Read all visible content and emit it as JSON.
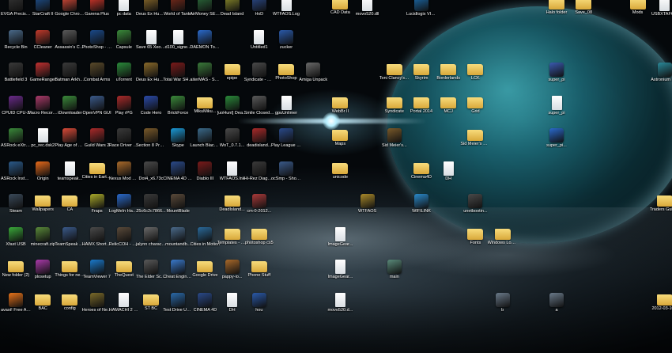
{
  "icons": [
    {
      "label": "EVGA Precision X",
      "col": 0,
      "row": 0,
      "kind": "app",
      "color": "#333333"
    },
    {
      "label": "StarCraft II",
      "col": 1,
      "row": 0,
      "kind": "app",
      "color": "#1d4f8c"
    },
    {
      "label": "Google Chrome",
      "col": 2,
      "row": 0,
      "kind": "app",
      "color": "#d94a38"
    },
    {
      "label": "Garena Plus",
      "col": 3,
      "row": 0,
      "kind": "app",
      "color": "#d8362a"
    },
    {
      "label": "pc data",
      "col": 4,
      "row": 0,
      "kind": "doc",
      "color": "#ffffff"
    },
    {
      "label": "Deus Ex Human R...",
      "col": 5,
      "row": 0,
      "kind": "app",
      "color": "#8a6a2a"
    },
    {
      "label": "World of Tanks",
      "col": 6,
      "row": 0,
      "kind": "app",
      "color": "#7a2a1a"
    },
    {
      "label": "AirMoney SE v7.38",
      "col": 7,
      "row": 0,
      "kind": "app",
      "color": "#2a6a3a"
    },
    {
      "label": "Dead Island",
      "col": 8,
      "row": 0,
      "kind": "app",
      "color": "#8a8a2a"
    },
    {
      "label": "HxD",
      "col": 9,
      "row": 0,
      "kind": "app",
      "color": "#2a4a8a"
    },
    {
      "label": "WTFAOS.Log",
      "col": 10,
      "row": 0,
      "kind": "doc",
      "color": "#ffffff"
    },
    {
      "label": "CAD Data",
      "col": 12,
      "row": 0,
      "kind": "folder",
      "color": "#e8c25a"
    },
    {
      "label": "movo520.dll",
      "col": 13,
      "row": 0,
      "kind": "doc",
      "color": "#ffffff"
    },
    {
      "label": "Lucidlogix VIRTU Settings",
      "col": 15,
      "row": 0,
      "kind": "app",
      "color": "#1a6aaa"
    },
    {
      "label": "Halo folder",
      "col": 20,
      "row": 0,
      "kind": "folder",
      "color": "#e8c25a"
    },
    {
      "label": "Save_08",
      "col": 21,
      "row": 0,
      "kind": "folder",
      "color": "#e8c25a"
    },
    {
      "label": "Mods",
      "col": 23,
      "row": 0,
      "kind": "folder",
      "color": "#e8c25a"
    },
    {
      "label": "USBXTAFG...",
      "col": 24,
      "row": 0,
      "kind": "doc",
      "color": "#ffffff"
    },
    {
      "label": "Recycle Bin",
      "col": 0,
      "row": 1,
      "kind": "app",
      "color": "#4a6a8a"
    },
    {
      "label": "CCleaner",
      "col": 1,
      "row": 1,
      "kind": "app",
      "color": "#c0392b"
    },
    {
      "label": "Assassin's Creed Re...",
      "col": 2,
      "row": 1,
      "kind": "app",
      "color": "#5a5a5a"
    },
    {
      "label": "PhotoShop - Shortcut",
      "col": 3,
      "row": 1,
      "kind": "app",
      "color": "#1a4a8a"
    },
    {
      "label": "Capsule",
      "col": 4,
      "row": 1,
      "kind": "app",
      "color": "#3a8a3a"
    },
    {
      "label": "Save 65 Xeon San...",
      "col": 5,
      "row": 1,
      "kind": "doc",
      "color": "#ffffff"
    },
    {
      "label": "d100_signe...",
      "col": 6,
      "row": 1,
      "kind": "doc",
      "color": "#ffffff"
    },
    {
      "label": "DAEMON Tools Lite",
      "col": 7,
      "row": 1,
      "kind": "app",
      "color": "#2a6acc"
    },
    {
      "label": "Untitled1",
      "col": 9,
      "row": 1,
      "kind": "doc",
      "color": "#ffffff"
    },
    {
      "label": "zucker",
      "col": 10,
      "row": 1,
      "kind": "app",
      "color": "#2a5aaa"
    },
    {
      "label": "Battlefield 3",
      "col": 0,
      "row": 2,
      "kind": "app",
      "color": "#3a3a3a"
    },
    {
      "label": "GameRanger",
      "col": 1,
      "row": 2,
      "kind": "app",
      "color": "#c03030"
    },
    {
      "label": "Batman Arkham City",
      "col": 2,
      "row": 2,
      "kind": "app",
      "color": "#3a3a3a"
    },
    {
      "label": "Combat Arms",
      "col": 3,
      "row": 2,
      "kind": "app",
      "color": "#5a4a2a"
    },
    {
      "label": "uTorrent",
      "col": 4,
      "row": 2,
      "kind": "app",
      "color": "#2a8a3a"
    },
    {
      "label": "Deus Ex Human Re...",
      "col": 5,
      "row": 2,
      "kind": "app",
      "color": "#8a6a2a"
    },
    {
      "label": "Total War SHOGUN 2",
      "col": 6,
      "row": 2,
      "kind": "app",
      "color": "#7a1a1a"
    },
    {
      "label": "aiterMAS - Shortcut",
      "col": 7,
      "row": 2,
      "kind": "app",
      "color": "#3a7a3a"
    },
    {
      "label": "epipe",
      "col": 8,
      "row": 2,
      "kind": "folder",
      "color": "#e8c25a"
    },
    {
      "label": "Syndicate - Shortcut",
      "col": 9,
      "row": 2,
      "kind": "app",
      "color": "#4a4a4a"
    },
    {
      "label": "PhotoShop",
      "col": 10,
      "row": 2,
      "kind": "folder",
      "color": "#e8c25a"
    },
    {
      "label": "Amiga Unpack",
      "col": 11,
      "row": 2,
      "kind": "app",
      "color": "#6a6a6a"
    },
    {
      "label": "Toni Clancy's H.A.W.X",
      "col": 14,
      "row": 2,
      "kind": "folder",
      "color": "#e8c25a"
    },
    {
      "label": "Skyrim",
      "col": 15,
      "row": 2,
      "kind": "folder",
      "color": "#e8c25a"
    },
    {
      "label": "Borderlands",
      "col": 16,
      "row": 2,
      "kind": "folder",
      "color": "#e8c25a"
    },
    {
      "label": "LCK",
      "col": 17,
      "row": 2,
      "kind": "folder",
      "color": "#e8c25a"
    },
    {
      "label": "super_pi",
      "col": 20,
      "row": 2,
      "kind": "app",
      "color": "#3a5ab0"
    },
    {
      "label": "Astronium Lite",
      "col": 24,
      "row": 2,
      "kind": "app",
      "color": "#2a8a9a"
    },
    {
      "label": "CPUID CPU-Z",
      "col": 0,
      "row": 3,
      "kind": "app",
      "color": "#6a2a8a"
    },
    {
      "label": "Macro Recorder",
      "col": 1,
      "row": 3,
      "kind": "app",
      "color": "#aa3a6a"
    },
    {
      "label": "iDownloader",
      "col": 2,
      "row": 3,
      "kind": "app",
      "color": "#3a8a3a"
    },
    {
      "label": "OpenVPN GUI",
      "col": 3,
      "row": 3,
      "kind": "app",
      "color": "#3a5a8a"
    },
    {
      "label": "Play rPG",
      "col": 4,
      "row": 3,
      "kind": "app",
      "color": "#aa2a2a"
    },
    {
      "label": "Code Hero",
      "col": 5,
      "row": 3,
      "kind": "app",
      "color": "#2a4aaa"
    },
    {
      "label": "BrickForce",
      "col": 6,
      "row": 3,
      "kind": "app",
      "color": "#3a8a3a"
    },
    {
      "label": "MikuMiku...",
      "col": 7,
      "row": 3,
      "kind": "folder",
      "color": "#e8c25a"
    },
    {
      "label": "[uoHunt] DeadIsland...",
      "col": 8,
      "row": 3,
      "kind": "app",
      "color": "#2a8a3a"
    },
    {
      "label": "Smile Closed Beta",
      "col": 9,
      "row": 3,
      "kind": "app",
      "color": "#5a5a5a"
    },
    {
      "label": "gpuUnlimer",
      "col": 10,
      "row": 3,
      "kind": "doc",
      "color": "#ffffff"
    },
    {
      "label": "WebBr II",
      "col": 12,
      "row": 3,
      "kind": "folder",
      "color": "#e8c25a"
    },
    {
      "label": "Syndicate",
      "col": 14,
      "row": 3,
      "kind": "folder",
      "color": "#e8c25a"
    },
    {
      "label": "Portal 2014",
      "col": 15,
      "row": 3,
      "kind": "folder",
      "color": "#e8c25a"
    },
    {
      "label": "MCJ",
      "col": 16,
      "row": 3,
      "kind": "folder",
      "color": "#e8c25a"
    },
    {
      "label": "Grid",
      "col": 17,
      "row": 3,
      "kind": "folder",
      "color": "#e8c25a"
    },
    {
      "label": "super_pi",
      "col": 20,
      "row": 3,
      "kind": "doc",
      "color": "#ffffff"
    },
    {
      "label": "ASRock eXtre...",
      "col": 0,
      "row": 4,
      "kind": "app",
      "color": "#3a8a3a"
    },
    {
      "label": "pc_rec.dsk2",
      "col": 1,
      "row": 4,
      "kind": "doc",
      "color": "#ffffff"
    },
    {
      "label": "Play Age of Empires",
      "col": 2,
      "row": 4,
      "kind": "app",
      "color": "#d94a38"
    },
    {
      "label": "Guild Wars 2",
      "col": 3,
      "row": 4,
      "kind": "app",
      "color": "#aa2a2a"
    },
    {
      "label": "Race Driver GRID",
      "col": 4,
      "row": 4,
      "kind": "app",
      "color": "#3a3a3a"
    },
    {
      "label": "Section 8 Prejudice",
      "col": 5,
      "row": 4,
      "kind": "app",
      "color": "#7a5a2a"
    },
    {
      "label": "Skype",
      "col": 6,
      "row": 4,
      "kind": "app",
      "color": "#1a9ad8"
    },
    {
      "label": "Launch Blacklight",
      "col": 7,
      "row": 4,
      "kind": "app",
      "color": "#3a6a8a"
    },
    {
      "label": "WoT_0.7.1...",
      "col": 8,
      "row": 4,
      "kind": "app",
      "color": "#4a4a4a"
    },
    {
      "label": "deadisland...",
      "col": 9,
      "row": 4,
      "kind": "app",
      "color": "#aa2a2a"
    },
    {
      "label": "Play League of Legends",
      "col": 10,
      "row": 4,
      "kind": "app",
      "color": "#2a4a8a"
    },
    {
      "label": "Maps",
      "col": 12,
      "row": 4,
      "kind": "folder",
      "color": "#e8c25a"
    },
    {
      "label": "Sid Meier's...",
      "col": 14,
      "row": 4,
      "kind": "app",
      "color": "#7a5a2a"
    },
    {
      "label": "Sid Meier's Civilization V",
      "col": 17,
      "row": 4,
      "kind": "folder",
      "color": "#e8c25a"
    },
    {
      "label": "super_pi...",
      "col": 20,
      "row": 4,
      "kind": "app",
      "color": "#2a6acc"
    },
    {
      "label": "ASRock InstantBoot",
      "col": 0,
      "row": 5,
      "kind": "app",
      "color": "#2a5a8a"
    },
    {
      "label": "Origin",
      "col": 1,
      "row": 5,
      "kind": "app",
      "color": "#e86a1a"
    },
    {
      "label": "teamspeak...",
      "col": 2,
      "row": 5,
      "kind": "doc",
      "color": "#ffffff"
    },
    {
      "label": "Cities in Earth 3D",
      "col": 3,
      "row": 5,
      "kind": "folder",
      "color": "#e8c25a"
    },
    {
      "label": "Nexus Mod Manager",
      "col": 4,
      "row": 5,
      "kind": "app",
      "color": "#aa6a2a"
    },
    {
      "label": "Dot4_x6.73c",
      "col": 5,
      "row": 5,
      "kind": "app",
      "color": "#4a4a4a"
    },
    {
      "label": "CINEMA 4D 64 Bit",
      "col": 6,
      "row": 5,
      "kind": "app",
      "color": "#2a4a8a"
    },
    {
      "label": "Diablo III",
      "col": 7,
      "row": 5,
      "kind": "app",
      "color": "#7a1a1a"
    },
    {
      "label": "WTFAOS.lnk",
      "col": 8,
      "row": 5,
      "kind": "doc",
      "color": "#ffffff"
    },
    {
      "label": "Hi-Rez Diagnostic...",
      "col": 9,
      "row": 5,
      "kind": "app",
      "color": "#3a3a3a"
    },
    {
      "label": "ocSmp - Shortcut",
      "col": 10,
      "row": 5,
      "kind": "app",
      "color": "#3a5a8a"
    },
    {
      "label": "unicode",
      "col": 12,
      "row": 5,
      "kind": "folder",
      "color": "#e8c25a"
    },
    {
      "label": "Cinema4D",
      "col": 15,
      "row": 5,
      "kind": "folder",
      "color": "#e8c25a"
    },
    {
      "label": "DH",
      "col": 16,
      "row": 5,
      "kind": "doc",
      "color": "#ffffff"
    },
    {
      "label": "Steam",
      "col": 0,
      "row": 6,
      "kind": "app",
      "color": "#3a4a5a"
    },
    {
      "label": "Wallpapers",
      "col": 1,
      "row": 6,
      "kind": "folder",
      "color": "#e8c25a"
    },
    {
      "label": "CA",
      "col": 2,
      "row": 6,
      "kind": "folder",
      "color": "#e8c25a"
    },
    {
      "label": "Fraps",
      "col": 3,
      "row": 6,
      "kind": "app",
      "color": "#aaaa2a"
    },
    {
      "label": "LogMeIn Hamachi",
      "col": 4,
      "row": 6,
      "kind": "app",
      "color": "#2a6acc"
    },
    {
      "label": "25c6c2c7866...",
      "col": 5,
      "row": 6,
      "kind": "app",
      "color": "#3a3a3a"
    },
    {
      "label": "MountBlade",
      "col": 6,
      "row": 6,
      "kind": "app",
      "color": "#5a4a3a"
    },
    {
      "label": "DeadIsland...",
      "col": 8,
      "row": 6,
      "kind": "folder",
      "color": "#e8c25a"
    },
    {
      "label": "cm-0-2012...",
      "col": 9,
      "row": 6,
      "kind": "app",
      "color": "#aa3a3a"
    },
    {
      "label": "WTFAOS",
      "col": 13,
      "row": 6,
      "kind": "app",
      "color": "#aa8a2a"
    },
    {
      "label": "WIFILINK",
      "col": 15,
      "row": 6,
      "kind": "app",
      "color": "#2a8acc"
    },
    {
      "label": "unetbootin...",
      "col": 17,
      "row": 6,
      "kind": "app",
      "color": "#4a4a4a"
    },
    {
      "label": "Traders Guild Game #3",
      "col": 24,
      "row": 6,
      "kind": "folder",
      "color": "#e8c25a"
    },
    {
      "label": "Xfast USB",
      "col": 0,
      "row": 7,
      "kind": "app",
      "color": "#3aaa3a"
    },
    {
      "label": "minecraft.zip",
      "col": 1,
      "row": 7,
      "kind": "app",
      "color": "#5a8a3a"
    },
    {
      "label": "TeamSpeak 3 Client",
      "col": 2,
      "row": 7,
      "kind": "app",
      "color": "#3a5a8a"
    },
    {
      "label": "HAWX Shortcut",
      "col": 3,
      "row": 7,
      "kind": "app",
      "color": "#4a4a4a"
    },
    {
      "label": "RelicCOH - Shortcut",
      "col": 4,
      "row": 7,
      "kind": "app",
      "color": "#5a4a3a"
    },
    {
      "label": "jalynn character",
      "col": 5,
      "row": 7,
      "kind": "app",
      "color": "#6a6a6a"
    },
    {
      "label": "mountandb...",
      "col": 6,
      "row": 7,
      "kind": "app",
      "color": "#4a6a8a"
    },
    {
      "label": "Cities in Motion",
      "col": 7,
      "row": 7,
      "kind": "app",
      "color": "#2a6a9a"
    },
    {
      "label": "Templates - Shortcut",
      "col": 8,
      "row": 7,
      "kind": "folder",
      "color": "#e8c25a"
    },
    {
      "label": "photoshop cs5",
      "col": 9,
      "row": 7,
      "kind": "folder",
      "color": "#e8c25a"
    },
    {
      "label": "ImageGear...",
      "col": 12,
      "row": 7,
      "kind": "doc",
      "color": "#ffffff"
    },
    {
      "label": "Fonts",
      "col": 17,
      "row": 7,
      "kind": "folder",
      "color": "#e8c25a"
    },
    {
      "label": "Windows Loader",
      "col": 18,
      "row": 7,
      "kind": "folder",
      "color": "#e8c25a"
    },
    {
      "label": "New folder (2)",
      "col": 0,
      "row": 8,
      "kind": "folder",
      "color": "#e8c25a"
    },
    {
      "label": "plosetup",
      "col": 1,
      "row": 8,
      "kind": "app",
      "color": "#aa3aaa"
    },
    {
      "label": "Things for new PC",
      "col": 2,
      "row": 8,
      "kind": "folder",
      "color": "#e8c25a"
    },
    {
      "label": "TeamViewer 7",
      "col": 3,
      "row": 8,
      "kind": "app",
      "color": "#1a7acc"
    },
    {
      "label": "TheQuest",
      "col": 4,
      "row": 8,
      "kind": "folder",
      "color": "#e8c25a"
    },
    {
      "label": "The Elder Scrolls ...",
      "col": 5,
      "row": 8,
      "kind": "app",
      "color": "#5a5a5a"
    },
    {
      "label": "Cheat Engine 6.1",
      "col": 6,
      "row": 8,
      "kind": "app",
      "color": "#3a7acc"
    },
    {
      "label": "Google Drive",
      "col": 7,
      "row": 8,
      "kind": "folder",
      "color": "#e8c25a"
    },
    {
      "label": "pappy-io...",
      "col": 8,
      "row": 8,
      "kind": "app",
      "color": "#aa6a2a"
    },
    {
      "label": "Phone Stuff",
      "col": 9,
      "row": 8,
      "kind": "folder",
      "color": "#e8c25a"
    },
    {
      "label": "ImageGear...",
      "col": 12,
      "row": 8,
      "kind": "doc",
      "color": "#ffffff"
    },
    {
      "label": "main",
      "col": 14,
      "row": 8,
      "kind": "app",
      "color": "#5a8a7a"
    },
    {
      "label": "avast! Free Antivirus",
      "col": 0,
      "row": 9,
      "kind": "app",
      "color": "#e8731a"
    },
    {
      "label": "BAC",
      "col": 1,
      "row": 9,
      "kind": "folder",
      "color": "#e8c25a"
    },
    {
      "label": "config",
      "col": 2,
      "row": 9,
      "kind": "folder",
      "color": "#e8c25a"
    },
    {
      "label": "Heroes of Newerth",
      "col": 3,
      "row": 9,
      "kind": "app",
      "color": "#7a6a2a"
    },
    {
      "label": "HAMACHI 2 BAND...",
      "col": 4,
      "row": 9,
      "kind": "doc",
      "color": "#ffffff"
    },
    {
      "label": "ST BC",
      "col": 5,
      "row": 9,
      "kind": "folder",
      "color": "#e8c25a"
    },
    {
      "label": "Test Drive Unlimited 2",
      "col": 6,
      "row": 9,
      "kind": "app",
      "color": "#2a6aaa"
    },
    {
      "label": "CINEMA 4D",
      "col": 7,
      "row": 9,
      "kind": "app",
      "color": "#2a4a8a"
    },
    {
      "label": "DH",
      "col": 8,
      "row": 9,
      "kind": "doc",
      "color": "#ffffff"
    },
    {
      "label": "hou",
      "col": 9,
      "row": 9,
      "kind": "app",
      "color": "#2a5aaa"
    },
    {
      "label": "movo520.d...",
      "col": 12,
      "row": 9,
      "kind": "doc",
      "color": "#ffffff"
    },
    {
      "label": "b",
      "col": 18,
      "row": 9,
      "kind": "app",
      "color": "#6a7a8a"
    },
    {
      "label": "a",
      "col": 20,
      "row": 9,
      "kind": "app",
      "color": "#6a7a8a"
    },
    {
      "label": "2012-03-10...",
      "col": 24,
      "row": 9,
      "kind": "folder",
      "color": "#e8c25a"
    }
  ]
}
